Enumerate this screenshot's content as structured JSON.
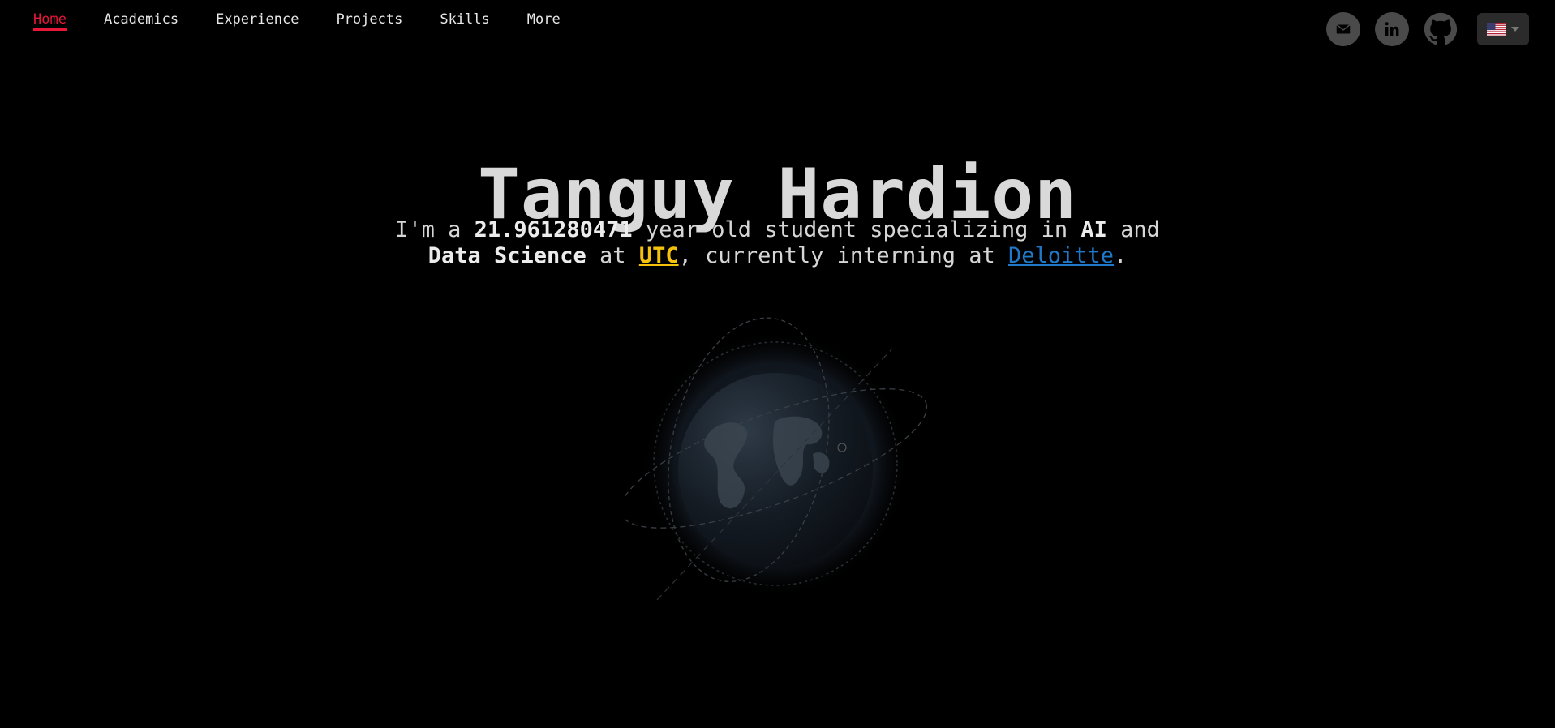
{
  "nav": {
    "items": [
      {
        "label": "Home",
        "active": true
      },
      {
        "label": "Academics"
      },
      {
        "label": "Experience"
      },
      {
        "label": "Projects"
      },
      {
        "label": "Skills"
      },
      {
        "label": "More"
      }
    ]
  },
  "social": {
    "icons": [
      "mail-icon",
      "linkedin-icon",
      "github-icon"
    ],
    "language": {
      "flag": "us-flag-icon",
      "selected": "English"
    }
  },
  "hero": {
    "name": "Tanguy Hardion",
    "tagline": {
      "prefix": "I'm a ",
      "age": "21.961280471",
      "mid1": " year-old student specializing in ",
      "field1": "AI",
      "mid2": " and",
      "field2": "Data Science",
      "mid3": " at ",
      "school": "UTC",
      "mid4": ", currently interning at ",
      "company": "Deloitte",
      "suffix": "."
    }
  },
  "colors": {
    "background": "#000000",
    "accent": "#e8173a",
    "utc": "#f4c20d",
    "link": "#1f78c8"
  }
}
